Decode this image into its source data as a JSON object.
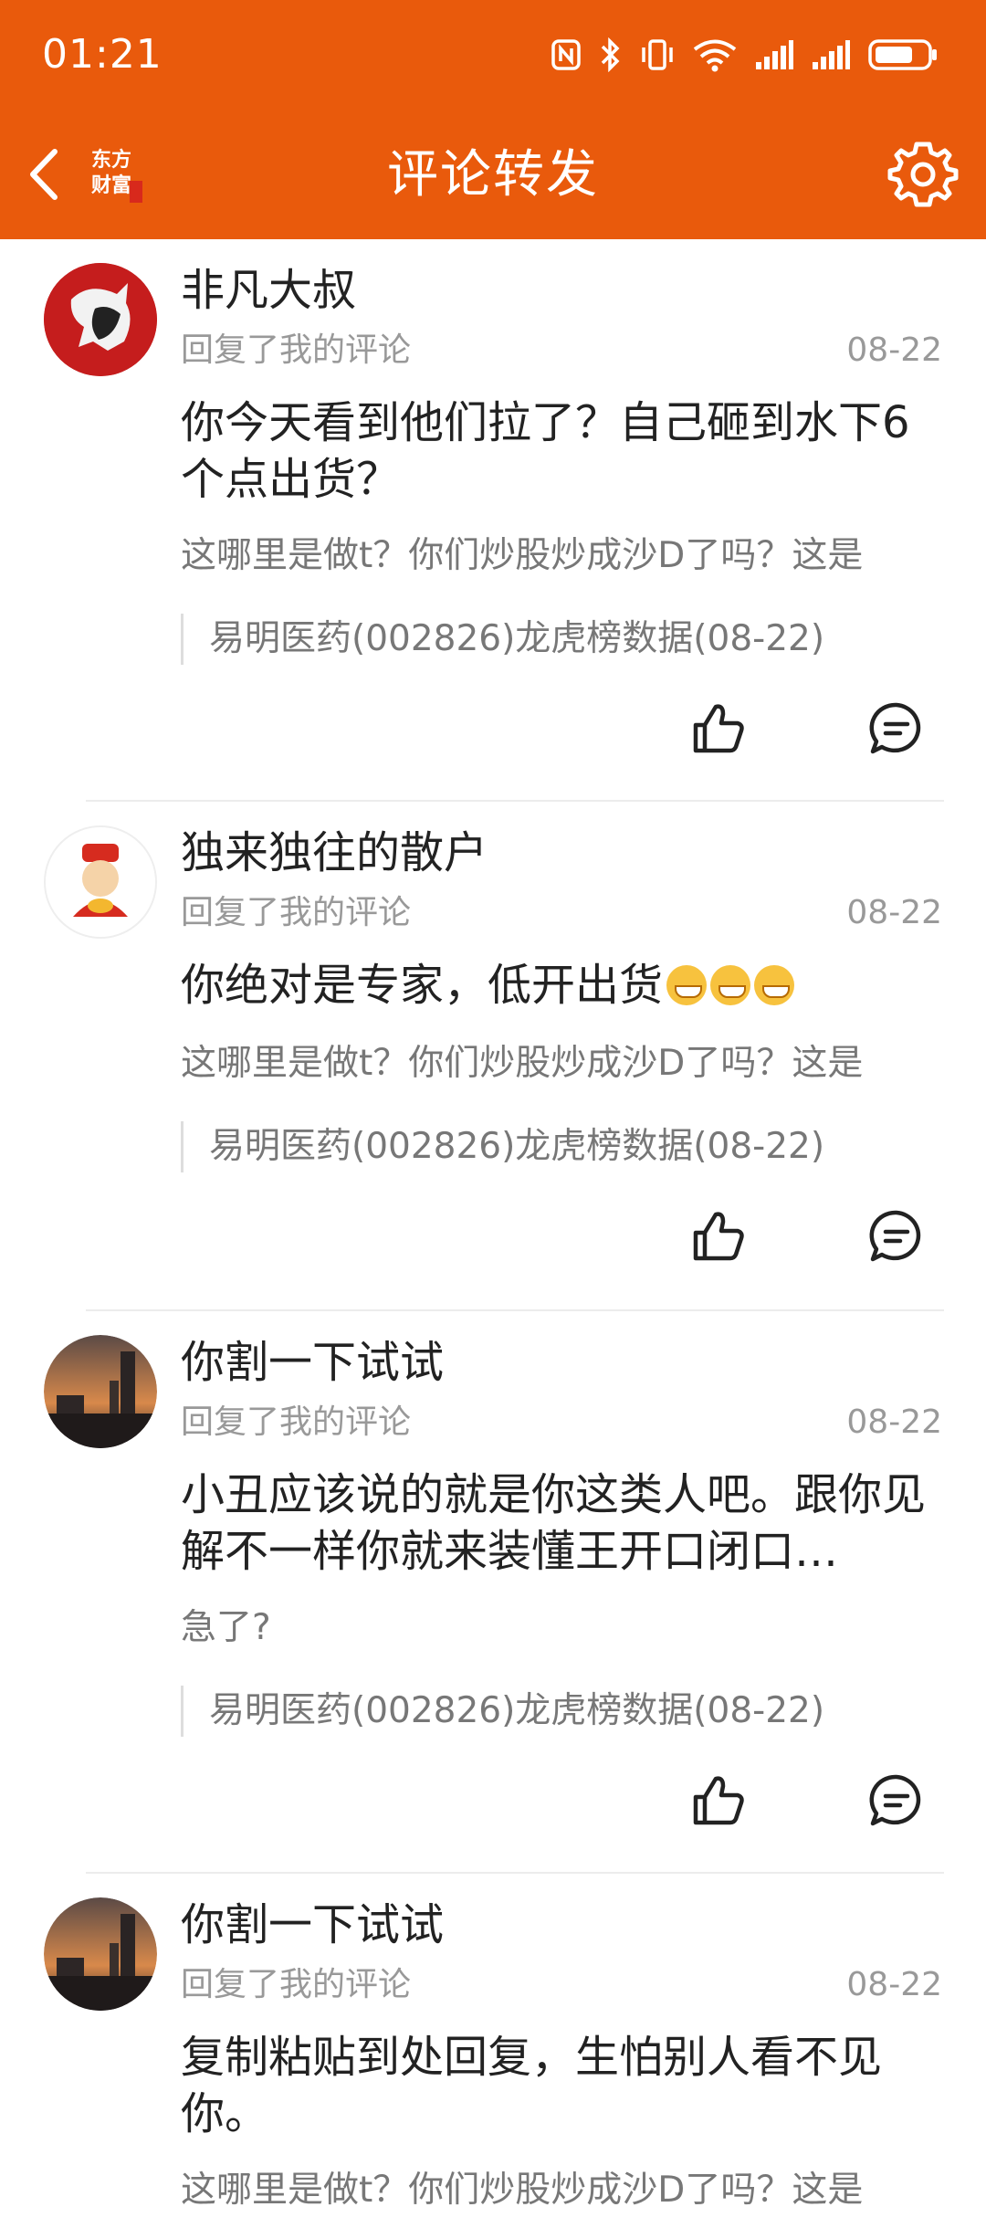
{
  "status_bar": {
    "time": "01:21",
    "icons": [
      "nfc-icon",
      "bluetooth-icon",
      "vibrate-icon",
      "wifi-icon",
      "signal-icon",
      "signal-icon",
      "battery-icon"
    ]
  },
  "navbar": {
    "title": "评论转发",
    "logo_text_line1": "东方",
    "logo_text_line2": "财富"
  },
  "colors": {
    "brand": "#E95A0C",
    "text_primary": "#222222",
    "text_secondary": "#999999"
  },
  "comments": [
    {
      "username": "非凡大叔",
      "subtitle": "回复了我的评论",
      "date": "08-22",
      "content": "你今天看到他们拉了？自己砸到水下6个点出货？",
      "quote": "这哪里是做t？你们炒股炒成沙D了吗？这是",
      "source": "易明医药(002826)龙虎榜数据(08-22)"
    },
    {
      "username": "独来独往的散户",
      "subtitle": "回复了我的评论",
      "date": "08-22",
      "content": "你绝对是专家，低开出货",
      "quote": "这哪里是做t？你们炒股炒成沙D了吗？这是",
      "source": "易明医药(002826)龙虎榜数据(08-22)"
    },
    {
      "username": "你割一下试试",
      "subtitle": "回复了我的评论",
      "date": "08-22",
      "content": "小丑应该说的就是你这类人吧。跟你见解不一样你就来装懂王开口闭口…",
      "quote": "急了?",
      "source": "易明医药(002826)龙虎榜数据(08-22)"
    },
    {
      "username": "你割一下试试",
      "subtitle": "回复了我的评论",
      "date": "08-22",
      "content": "复制粘贴到处回复，生怕别人看不见你。",
      "quote": "这哪里是做t？你们炒股炒成沙D了吗？这是"
    }
  ]
}
